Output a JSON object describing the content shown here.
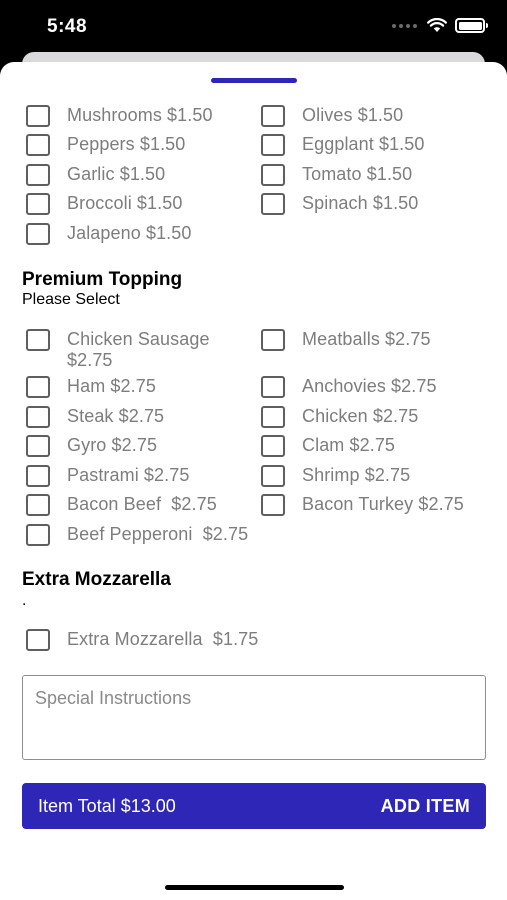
{
  "status": {
    "time": "5:48"
  },
  "toppings": [
    {
      "label": "Mushrooms $1.50"
    },
    {
      "label": "Olives $1.50"
    },
    {
      "label": "Peppers $1.50"
    },
    {
      "label": "Eggplant $1.50"
    },
    {
      "label": "Garlic $1.50"
    },
    {
      "label": "Tomato $1.50"
    },
    {
      "label": "Broccoli $1.50"
    },
    {
      "label": "Spinach $1.50"
    },
    {
      "label": "Jalapeno $1.50"
    }
  ],
  "premium": {
    "title": "Premium Topping",
    "subtitle": "Please Select",
    "items": [
      {
        "label": "Chicken Sausage\n$2.75"
      },
      {
        "label": "Meatballs $2.75"
      },
      {
        "label": "Ham $2.75"
      },
      {
        "label": "Anchovies $2.75"
      },
      {
        "label": "Steak $2.75"
      },
      {
        "label": "Chicken $2.75"
      },
      {
        "label": "Gyro $2.75"
      },
      {
        "label": "Clam $2.75"
      },
      {
        "label": "Pastrami $2.75"
      },
      {
        "label": "Shrimp $2.75"
      },
      {
        "label": "Bacon Beef  $2.75"
      },
      {
        "label": "Bacon Turkey $2.75"
      },
      {
        "label": "Beef Pepperoni  $2.75"
      }
    ]
  },
  "extra": {
    "title": "Extra Mozzarella",
    "subtitle": ".",
    "items": [
      {
        "label": "Extra Mozzarella  $1.75"
      }
    ]
  },
  "instructions": {
    "placeholder": "Special Instructions"
  },
  "footer": {
    "total": "Item Total $13.00",
    "add_label": "ADD ITEM"
  },
  "colors": {
    "accent": "#2d26b7",
    "label": "#7d7d7d"
  }
}
